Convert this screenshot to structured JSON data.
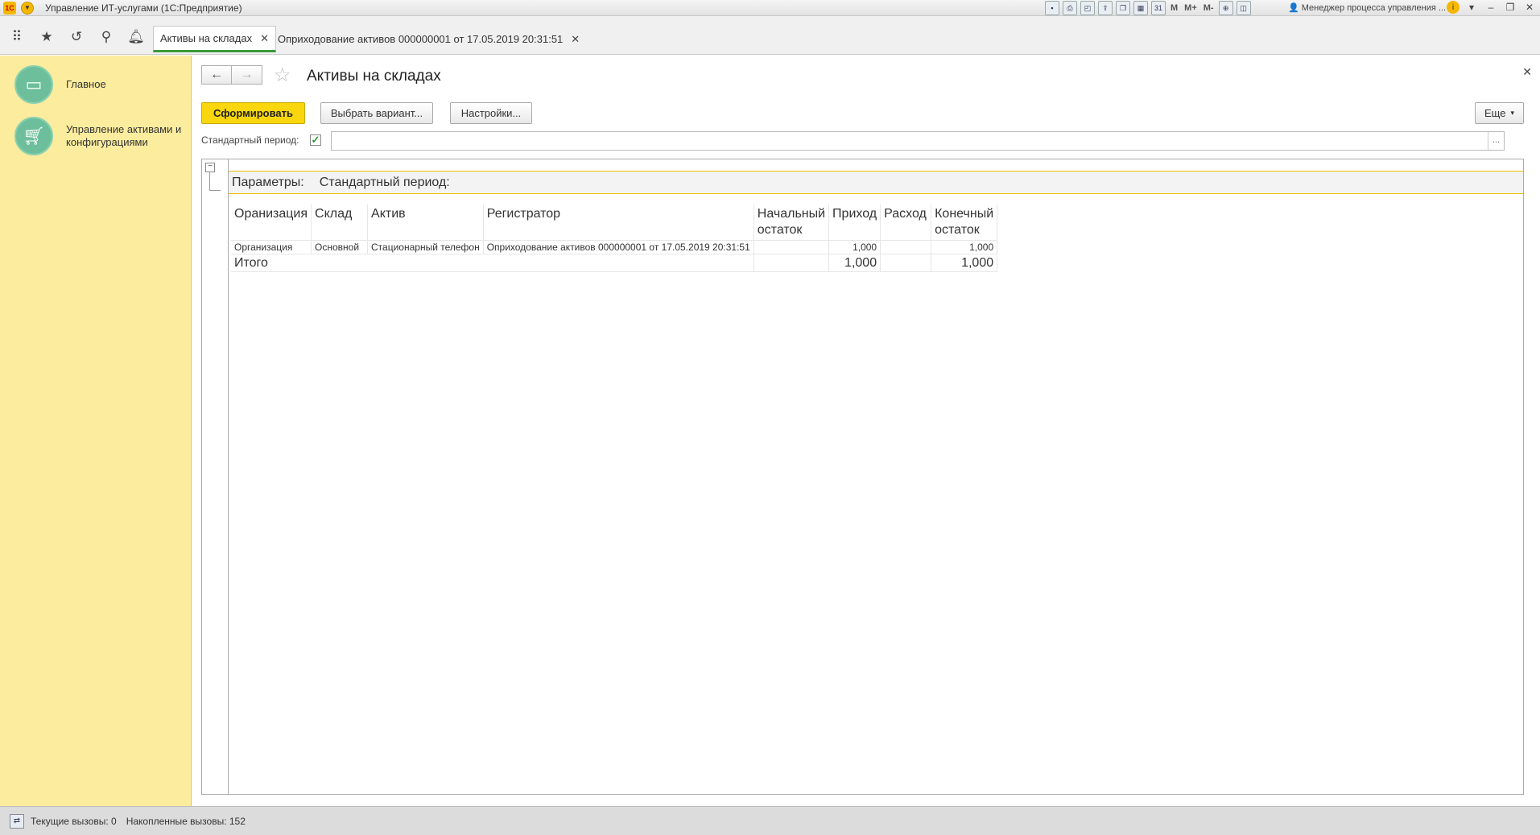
{
  "window": {
    "title": "Управление ИТ-услугами  (1С:Предприятие)",
    "user": "Менеджер процесса управления ...",
    "toolbar_letters": [
      "M",
      "M+",
      "M-"
    ]
  },
  "tabs": [
    {
      "label": "Активы на складах",
      "active": true
    },
    {
      "label": "Оприходование активов 000000001 от 17.05.2019 20:31:51",
      "active": false
    }
  ],
  "sidebar": {
    "items": [
      {
        "label": "Главное",
        "icon": "monitor-icon"
      },
      {
        "label": "Управление активами и конфигурациями",
        "icon": "cart-icon"
      }
    ]
  },
  "page": {
    "title": "Активы на складах",
    "buttons": {
      "generate": "Сформировать",
      "variant": "Выбрать вариант...",
      "settings": "Настройки...",
      "more": "Еще"
    },
    "period_label": "Стандартный период:",
    "period_checked": true,
    "period_value": "",
    "period_dots": "..."
  },
  "report": {
    "params_label": "Параметры:",
    "params_value": "Стандартный период:",
    "columns": [
      "Оранизация",
      "Склад",
      "Актив",
      "Регистратор",
      "Начальный остаток",
      "Приход",
      "Расход",
      "Конечный остаток"
    ],
    "rows": [
      {
        "org": "Организация",
        "warehouse": "Основной",
        "asset": "Стационарный телефон",
        "registrar": "Оприходование активов 000000001 от 17.05.2019 20:31:51",
        "start": "",
        "income": "1,000",
        "expense": "",
        "end": "1,000"
      }
    ],
    "total": {
      "label": "Итого",
      "start": "",
      "income": "1,000",
      "expense": "",
      "end": "1,000"
    }
  },
  "status": {
    "current_calls": "Текущие вызовы: 0",
    "accumulated_calls": "Накопленные вызовы: 152"
  },
  "colors": {
    "accent_yellow": "#f9d70c",
    "sidebar_bg": "#fcec9e",
    "active_tab_underline": "#3a9a3a",
    "checkbox_check": "#2a9a2a"
  }
}
